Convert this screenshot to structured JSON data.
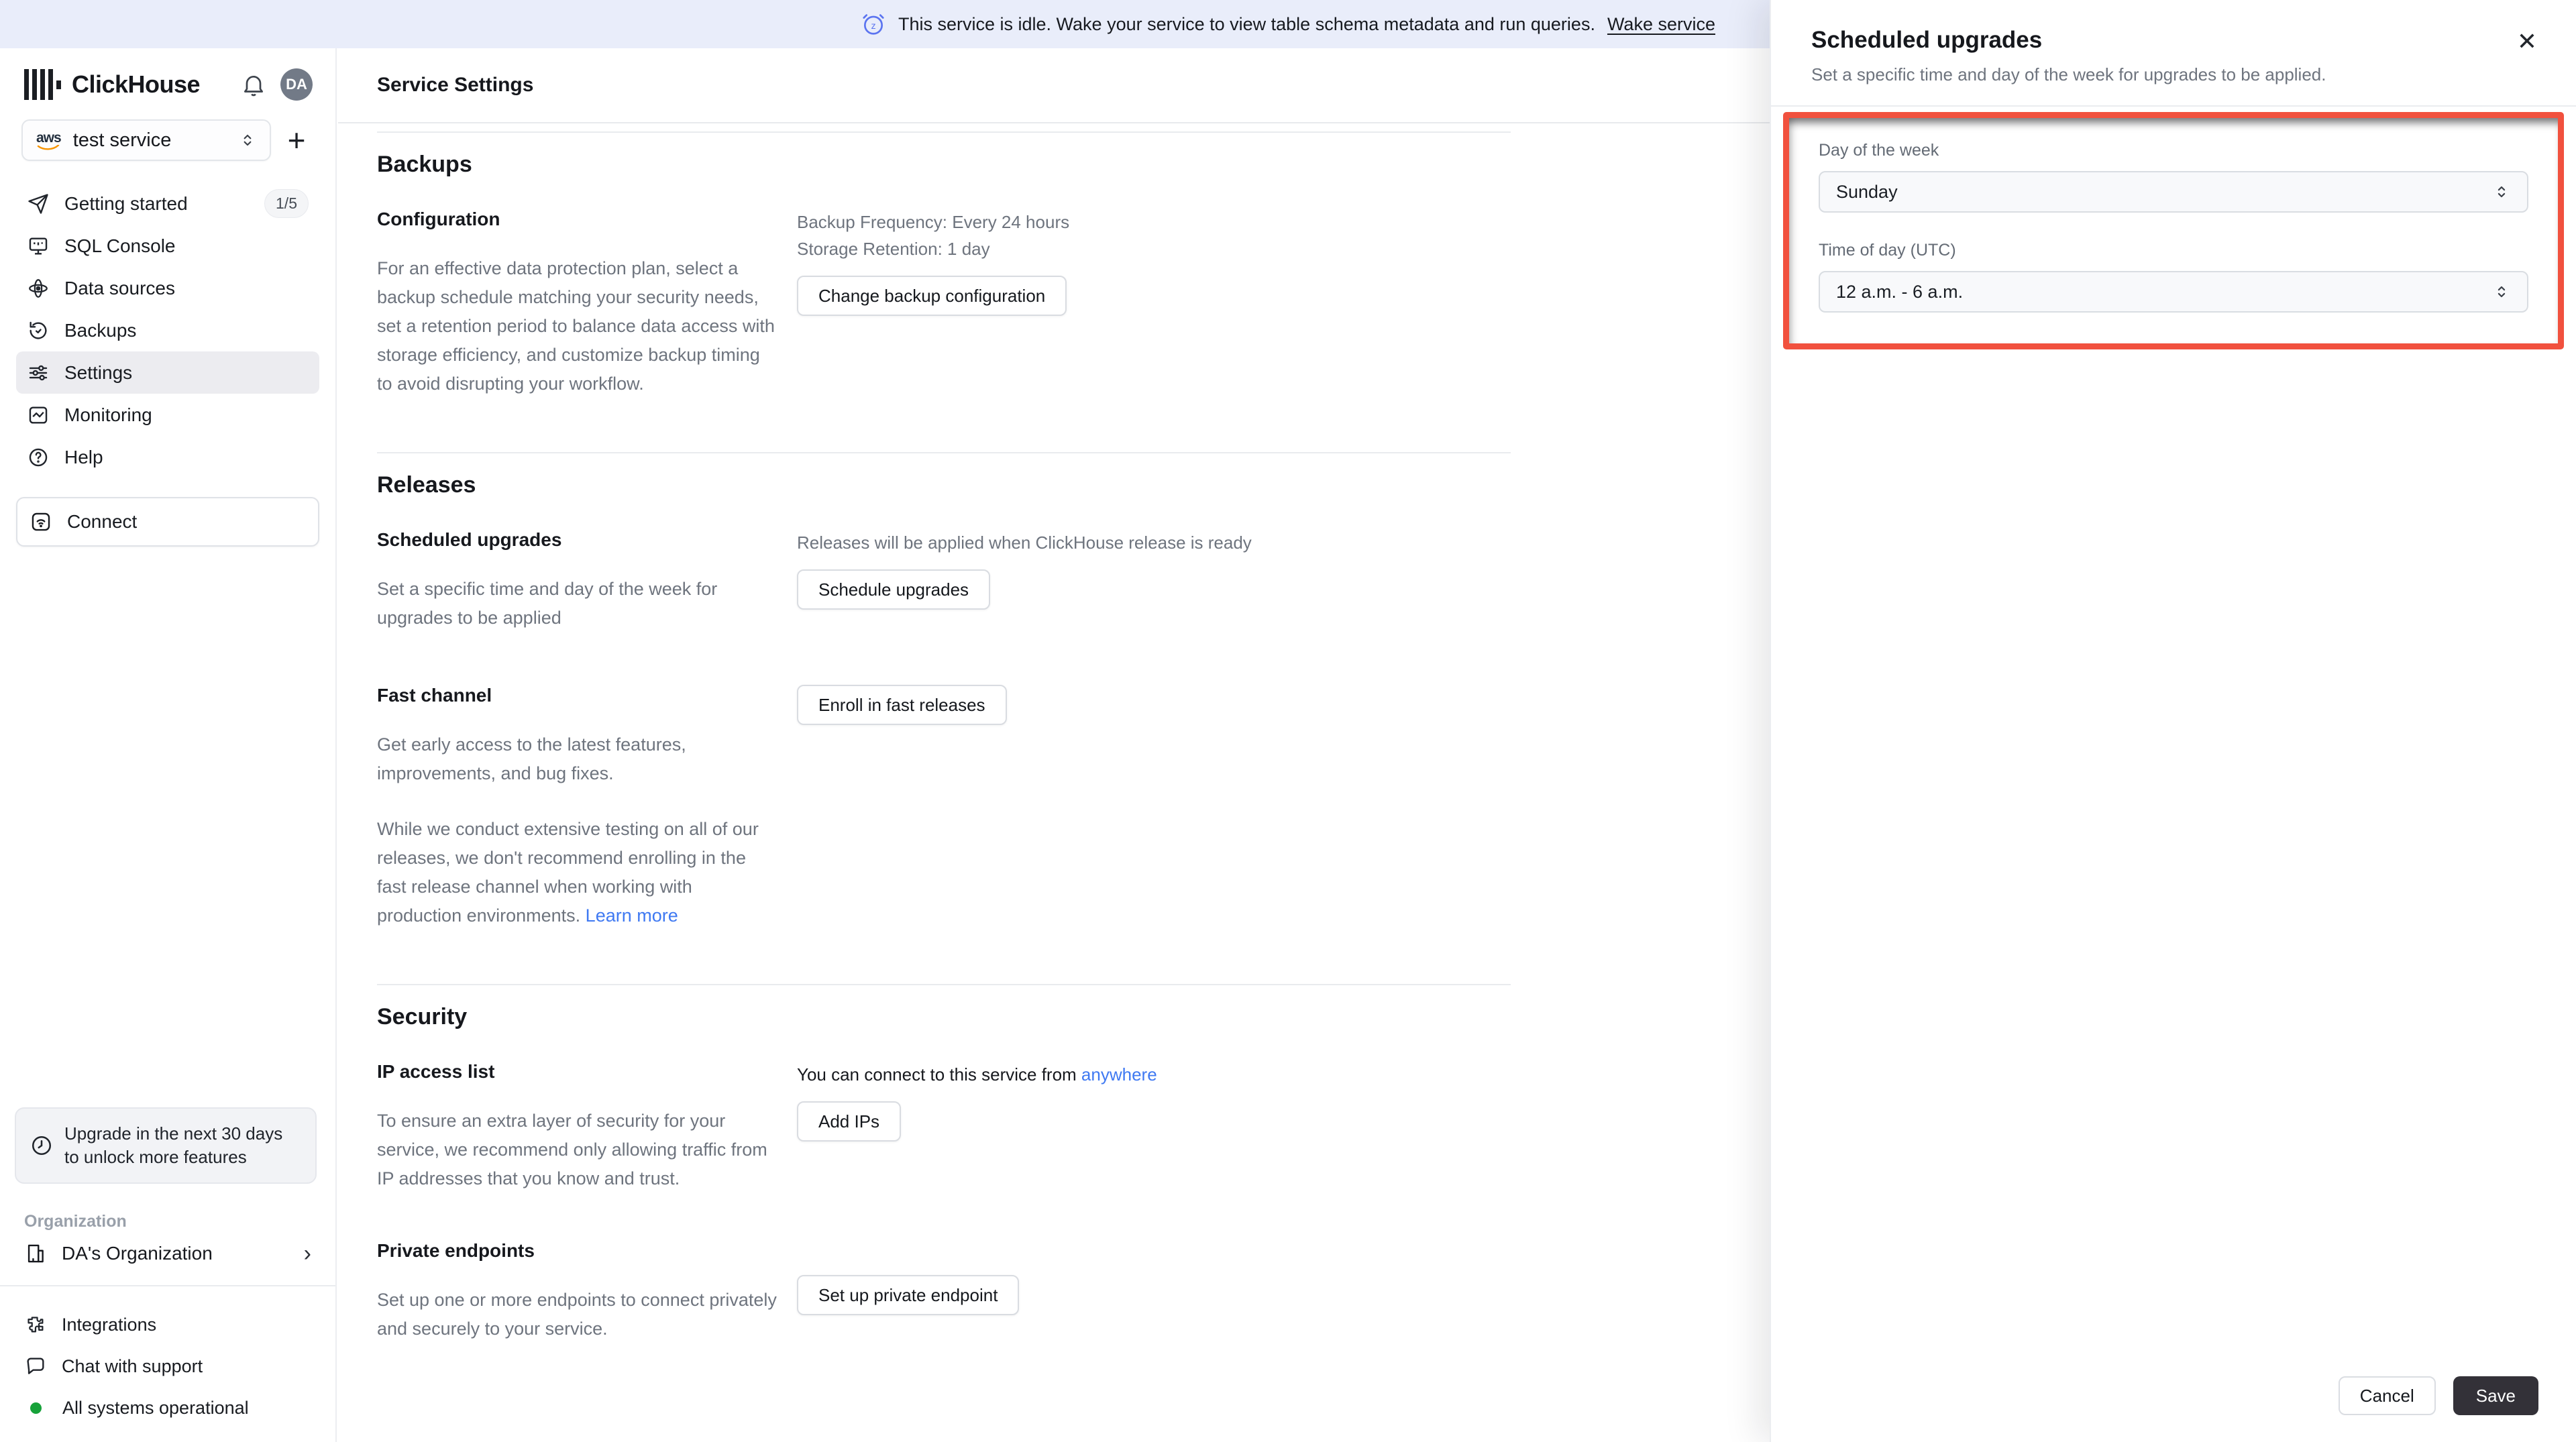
{
  "banner": {
    "text": "This service is idle. Wake your service to view table schema metadata and run queries.",
    "link": "Wake service"
  },
  "icons": {
    "close": "✕",
    "plus": "+",
    "chevron_right": "›"
  },
  "sidebar": {
    "brand": "ClickHouse",
    "avatar": "DA",
    "service_selector": {
      "label": "test service",
      "provider": "aws"
    },
    "nav": [
      {
        "label": "Getting started",
        "badge": "1/5"
      },
      {
        "label": "SQL Console"
      },
      {
        "label": "Data sources"
      },
      {
        "label": "Backups"
      },
      {
        "label": "Settings"
      },
      {
        "label": "Monitoring"
      },
      {
        "label": "Help"
      }
    ],
    "connect_label": "Connect",
    "upgrade_notice": "Upgrade in the next 30 days to unlock more features",
    "org_section_label": "Organization",
    "org_name": "DA's Organization",
    "footer": {
      "integrations": "Integrations",
      "chat": "Chat with support",
      "status": "All systems operational"
    }
  },
  "main": {
    "title": "Service Settings",
    "backups": {
      "heading": "Backups",
      "config_label": "Configuration",
      "frequency": "Backup Frequency: Every 24 hours",
      "retention": "Storage Retention: 1 day",
      "change_btn": "Change backup configuration",
      "desc": "For an effective data protection plan, select a backup schedule matching your security needs, set a retention period to balance data access with storage efficiency, and customize backup timing to avoid disrupting your workflow."
    },
    "releases": {
      "heading": "Releases",
      "scheduled_label": "Scheduled upgrades",
      "note": "Releases will be applied when ClickHouse release is ready",
      "schedule_btn": "Schedule upgrades",
      "scheduled_desc": "Set a specific time and day of the week for upgrades to be applied",
      "fast_label": "Fast channel",
      "enroll_btn": "Enroll in fast releases",
      "fast_desc1": "Get early access to the latest features, improvements, and bug fixes.",
      "fast_desc2": "While we conduct extensive testing on all of our releases, we don't recommend enrolling in the fast release channel when working with production environments. ",
      "learn_more": "Learn more"
    },
    "security": {
      "heading": "Security",
      "ip_label": "IP access list",
      "connect_note": "You can connect to this service from ",
      "anywhere": "anywhere",
      "add_ips_btn": "Add IPs",
      "ip_desc": "To ensure an extra layer of security for your service, we recommend only allowing traffic from IP addresses that you know and trust.",
      "pe_label": "Private endpoints",
      "pe_desc": "Set up one or more endpoints to connect privately and securely to your service.",
      "pe_btn": "Set up private endpoint"
    }
  },
  "panel": {
    "title": "Scheduled upgrades",
    "description": "Set a specific time and day of the week for upgrades to be applied.",
    "fields": [
      {
        "label": "Day of the week",
        "value": "Sunday"
      },
      {
        "label": "Time of day (UTC)",
        "value": "12 a.m. - 6 a.m."
      }
    ],
    "cancel_label": "Cancel",
    "save_label": "Save"
  }
}
